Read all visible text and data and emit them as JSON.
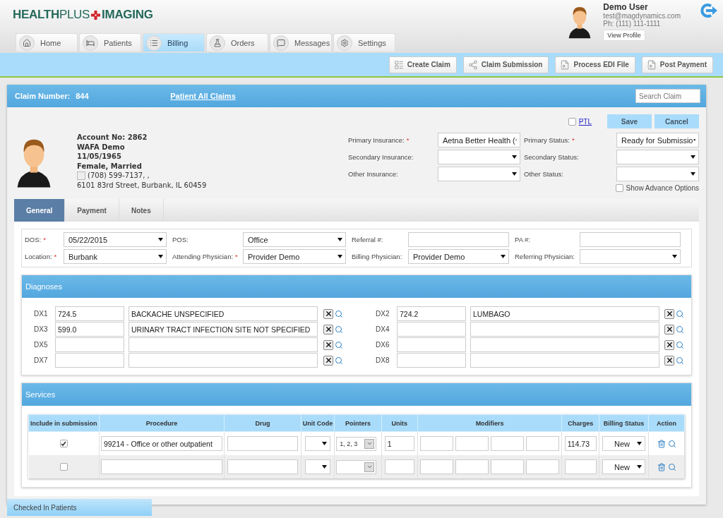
{
  "logo": {
    "name": "**HEALTH**PLUS",
    "suffix": "IMAGING"
  },
  "user": {
    "name": "Demo User",
    "email": "test@magdynamics.com",
    "phone": "Ph: (111) 111-1111",
    "profile_button": "View Profile"
  },
  "nav_tabs": [
    {
      "label": "Home",
      "selected": false
    },
    {
      "label": "Patients",
      "selected": false
    },
    {
      "label": "Billing",
      "selected": true
    },
    {
      "label": "Orders",
      "selected": false
    },
    {
      "label": "Messages",
      "selected": false
    },
    {
      "label": "Settings",
      "selected": false
    }
  ],
  "toolbar_buttons": [
    "Create Claim",
    "Claim Submission",
    "Process EDI File",
    "Post Payment"
  ],
  "claim_header": {
    "label": "Claim Number:",
    "number": "844",
    "link": "Patient All Claims",
    "search_placeholder": "Search Claim"
  },
  "ptl": {
    "label": "PTL",
    "checked": false
  },
  "action_buttons": [
    "Save",
    "Cancel"
  ],
  "patient": {
    "account": "Account No: 2862",
    "name": "WAFA Demo",
    "dob": "11/05/1965",
    "gender": "Female, Married",
    "phone": "(708) 599-7137, ,",
    "address": "6101 83rd Street, Burbank, IL 60459"
  },
  "insurance_fields": [
    {
      "label": "Primary Insurance:",
      "mark": "*",
      "value": "Aetna Better Health ("
    },
    {
      "label": "Primary Status:",
      "mark": "*",
      "value": "Ready for Submissio"
    },
    {
      "label": "Secondary Insurance:"
    },
    {
      "label": "Secondary Status:"
    },
    {
      "label": "Other Insurance:"
    },
    {
      "label": "Other Status:"
    }
  ],
  "show_advance": {
    "label": "Show Advance Options",
    "checked": false
  },
  "detail_tabs": [
    {
      "label": "General",
      "selected": true
    },
    {
      "label": "Payment",
      "selected": false
    },
    {
      "label": "Notes",
      "selected": false
    }
  ],
  "encounter_fields": [
    {
      "label": "DOS:",
      "mark": "*",
      "kind": "select",
      "value": "05/22/2015"
    },
    {
      "label": "POS:",
      "kind": "select",
      "value": "Office"
    },
    {
      "label": "Referral #:",
      "kind": "input"
    },
    {
      "label": "PA #:",
      "kind": "input"
    },
    {
      "label": "Location:",
      "mark": "*",
      "kind": "select",
      "value": "Burbank"
    },
    {
      "label": "Attending Physician:",
      "mark": "*",
      "kind": "select",
      "value": "Provider Demo"
    },
    {
      "label": "Billing Physician:",
      "kind": "select",
      "value": "Provider Demo"
    },
    {
      "label": "Referring Physician:",
      "kind": "select"
    }
  ],
  "diagnoses": {
    "title": "Diagnoses",
    "items": [
      {
        "label": "DX1",
        "code": "724.5",
        "description": "BACKACHE UNSPECIFIED"
      },
      {
        "label": "DX2",
        "code": "724.2",
        "description": "LUMBAGO"
      },
      {
        "label": "DX3",
        "code": "599.0",
        "description": "URINARY TRACT INFECTION SITE NOT SPECIFIED"
      },
      {
        "label": "DX4"
      },
      {
        "label": "DX5"
      },
      {
        "label": "DX6"
      },
      {
        "label": "DX7"
      },
      {
        "label": "DX8"
      }
    ]
  },
  "services": {
    "title": "Services",
    "columns": [
      "Include in submission",
      "Procedure",
      "Drug",
      "Unit Code",
      "Pointers",
      "Units",
      "Modifiers",
      "Charges",
      "Billing Status",
      "Action"
    ],
    "rows": [
      {
        "include": true,
        "procedure": "99214 - Office or other outpatient",
        "pointers": "1, 2, 3",
        "units": "1",
        "charges": "114.73",
        "billing_status": "New"
      },
      {
        "include": false,
        "billing_status": "New"
      }
    ]
  },
  "footer_tab": "Checked In Patients"
}
